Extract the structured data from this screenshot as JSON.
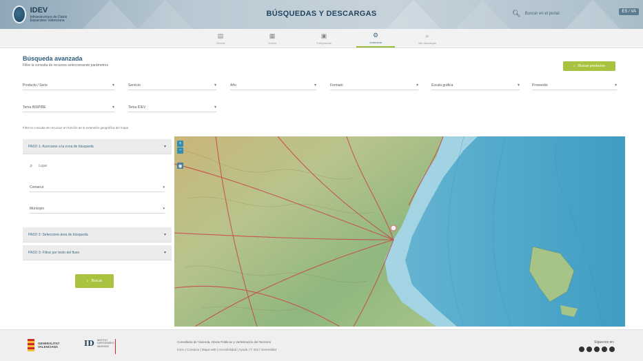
{
  "header": {
    "logo_title": "IDEV",
    "logo_subtitle": "Infraestructura de Datos Espaciales Valenciana",
    "page_title": "BÚSQUEDAS Y DESCARGAS",
    "search_placeholder": "Buscar en el portal",
    "lang_label": "ES / VA"
  },
  "nav": {
    "items": [
      {
        "label": "Ofertas",
        "icon": "folder-icon"
      },
      {
        "label": "Vuelos",
        "icon": "grid-icon"
      },
      {
        "label": "Fotogramas",
        "icon": "image-icon"
      },
      {
        "label": "Avanzada",
        "icon": "gear-icon",
        "active": true
      },
      {
        "label": "Mis descargas",
        "icon": "search-icon"
      }
    ]
  },
  "main": {
    "title": "Búsqueda avanzada",
    "subtitle": "Filtre la consulta de recursos seleccionando parámetros",
    "search_button": "Buscar productos",
    "filters": [
      "Producto / Serie",
      "Servicio",
      "Año",
      "Formato",
      "Escala gráfica",
      "Proveedor",
      "Tema INSPIRE",
      "Tema IDEV"
    ],
    "map_caption": "Filtre la consulta de recursos en función de la extensión geográfica del mapa"
  },
  "panel": {
    "step1": "PASO 1: Acercarse a la zona de búsqueda",
    "search_place": "Lugar",
    "field1": "Comarca",
    "field2": "Municipio",
    "step2": "PASO 2: Seleccione área de búsqueda",
    "step3": "PASO 3: Filtrar por texto del fluxo",
    "button": "Buscar"
  },
  "map": {
    "zoom_in": "+",
    "zoom_out": "−",
    "locate": "◉",
    "land_color": "#b7c78c",
    "sea_color": "#7fc2d8",
    "deep_sea_color": "#4aa5c8"
  },
  "footer": {
    "gva_line1": "GENERALITAT",
    "gva_line2": "VALENCIANA",
    "ide_mark": "ID",
    "ide_text": "INSTITUT CARTOGRÀFIC VALENCIÀ",
    "text1": "Conselleria de Vivienda, Obras Públicas y Vertebración del Territorio",
    "text2": "Inicio  |  Contacto  |  Mapa web  |  Accesibilidad  |  Ayuda  |  © 2017 Generalitat",
    "follow": "Síguenos en:"
  },
  "colors": {
    "accent": "#a9c23f",
    "brand": "#2d5a7a"
  }
}
